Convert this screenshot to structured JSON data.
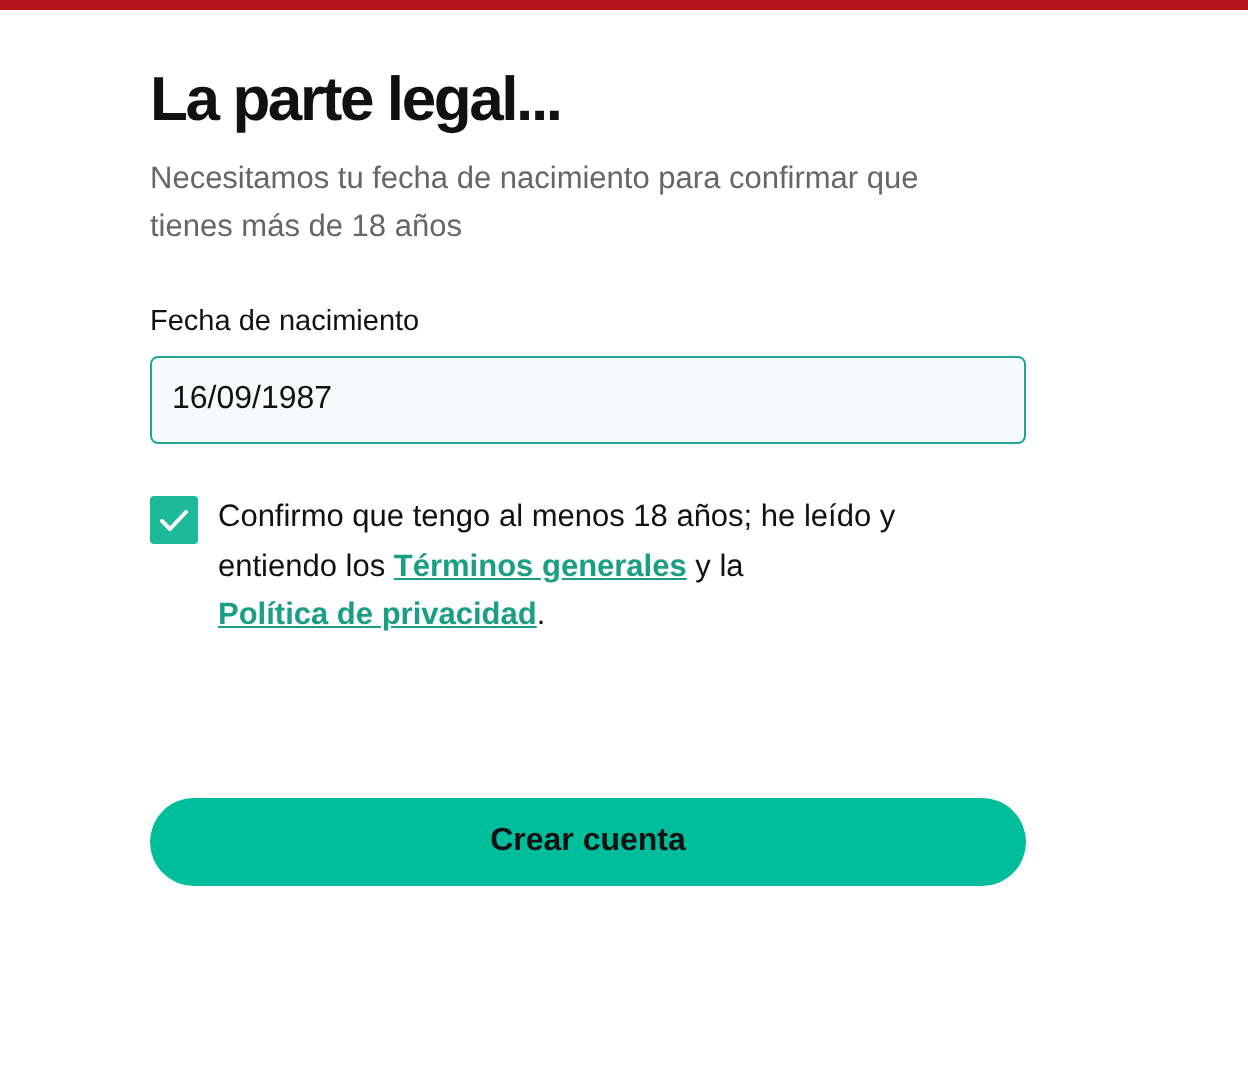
{
  "title": "La parte legal...",
  "subtitle": "Necesitamos tu fecha de nacimiento para confirmar que tienes más de 18 años",
  "birthdate": {
    "label": "Fecha de nacimiento",
    "value": "16/09/1987"
  },
  "consent": {
    "checked": true,
    "parts": [
      {
        "kind": "text",
        "text": "Confirmo que tengo al menos 18 años; he leído y entiendo los "
      },
      {
        "kind": "link",
        "text": "Términos generales"
      },
      {
        "kind": "text",
        "text": " y la "
      },
      {
        "kind": "link",
        "text": "Política de privacidad"
      },
      {
        "kind": "text",
        "text": "."
      }
    ]
  },
  "submit": {
    "label": "Crear cuenta"
  }
}
